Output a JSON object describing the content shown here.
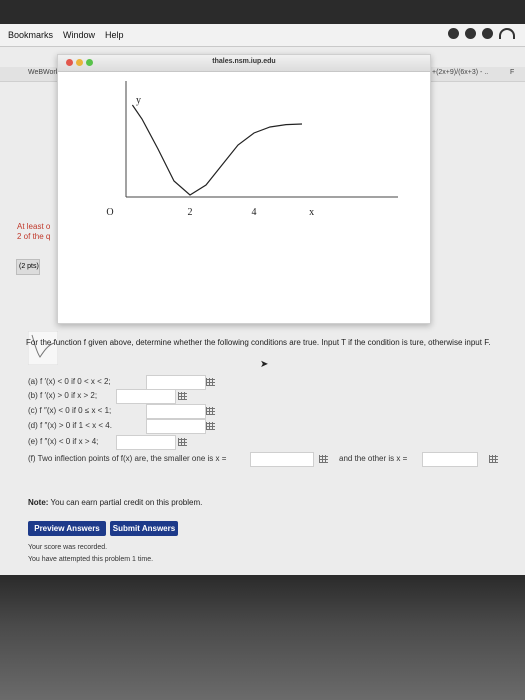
{
  "menubar": {
    "items": [
      "Bookmarks",
      "Window",
      "Help"
    ]
  },
  "page": {
    "tab_left": "WeBWork",
    "tab_right": "+(2x+9)/(6x+3) - ..",
    "tab_f": "F",
    "at_least_1": "At least o",
    "at_least_2": "2 of the q",
    "pts": "(2 pts)",
    "question": "For the function f given above, determine whether the following conditions are true. Input T if the condition is ture, otherwise input F.",
    "parts": [
      "(a) f ′(x) < 0 if 0 < x < 2;",
      "(b) f ′(x) > 0 if x > 2;",
      "(c) f ″(x) < 0 if 0 ≤ x < 1;",
      "(d) f ″(x) > 0 if 1 < x < 4.",
      "(e) f ″(x) < 0 if x > 4;",
      "(f) Two inflection points of f(x) are, the smaller one is x ="
    ],
    "part_f_other": "and the other is x =",
    "note_label": "Note:",
    "note_text": " You can earn partial credit on this problem.",
    "preview_button": "Preview Answers",
    "submit_button": "Submit Answers",
    "status_1": "Your score was recorded.",
    "status_2": "You have attempted this problem 1 time."
  },
  "popup": {
    "title": "thales.nsm.iup.edu"
  },
  "chart_data": {
    "type": "line",
    "xlabel": "x",
    "ylabel": "y",
    "x_ticks": [
      "O",
      "2",
      "4"
    ],
    "points": [
      [
        0.2,
        4.6
      ],
      [
        0.5,
        3.9
      ],
      [
        1.0,
        2.4
      ],
      [
        1.5,
        0.8
      ],
      [
        2.0,
        0.1
      ],
      [
        2.5,
        0.6
      ],
      [
        3.0,
        1.6
      ],
      [
        3.5,
        2.6
      ],
      [
        4.0,
        3.2
      ],
      [
        4.5,
        3.5
      ],
      [
        5.0,
        3.62
      ],
      [
        5.5,
        3.65
      ]
    ]
  },
  "colors": {
    "button": "#1d3a8a",
    "warning_text": "#c0392b"
  }
}
